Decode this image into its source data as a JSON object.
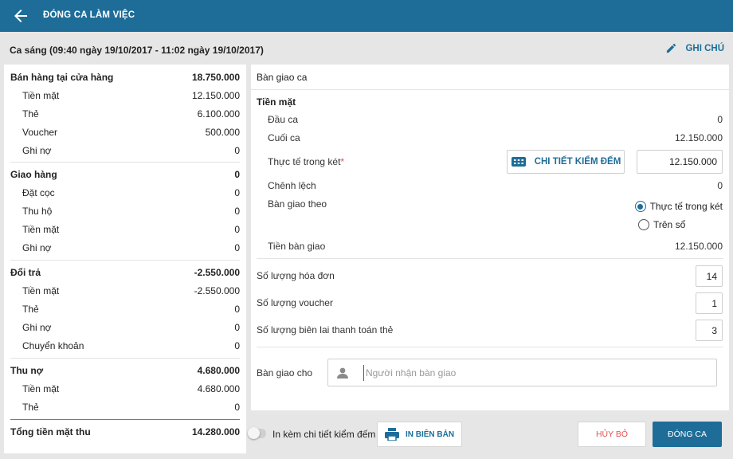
{
  "header": {
    "title": "ĐÓNG CA LÀM VIỆC"
  },
  "subheader": {
    "shift": "Ca sáng (09:40 ngày 19/10/2017 - 11:02 ngày 19/10/2017)",
    "note_label": "GHI CHÚ"
  },
  "summary": {
    "store_sales": {
      "label": "Bán hàng tại cửa hàng",
      "value": "18.750.000",
      "items": [
        {
          "label": "Tiền mặt",
          "value": "12.150.000"
        },
        {
          "label": "Thẻ",
          "value": "6.100.000"
        },
        {
          "label": "Voucher",
          "value": "500.000"
        },
        {
          "label": "Ghi nợ",
          "value": "0"
        }
      ]
    },
    "delivery": {
      "label": "Giao hàng",
      "value": "0",
      "items": [
        {
          "label": "Đặt cọc",
          "value": "0"
        },
        {
          "label": "Thu hộ",
          "value": "0"
        },
        {
          "label": "Tiền mặt",
          "value": "0"
        },
        {
          "label": "Ghi nợ",
          "value": "0"
        }
      ]
    },
    "returns": {
      "label": "Đổi trả",
      "value": "-2.550.000",
      "items": [
        {
          "label": "Tiền mặt",
          "value": "-2.550.000"
        },
        {
          "label": "Thẻ",
          "value": "0"
        },
        {
          "label": "Ghi nợ",
          "value": "0"
        },
        {
          "label": "Chuyển khoản",
          "value": "0"
        }
      ]
    },
    "debt_collection": {
      "label": "Thu nợ",
      "value": "4.680.000",
      "items": [
        {
          "label": "Tiền mặt",
          "value": "4.680.000"
        },
        {
          "label": "Thẻ",
          "value": "0"
        }
      ]
    },
    "total": {
      "label": "Tổng tiền mặt thu",
      "value": "14.280.000"
    }
  },
  "handover": {
    "title": "Bàn giao ca",
    "cash_section": "Tiền mặt",
    "opening": {
      "label": "Đầu ca",
      "value": "0"
    },
    "closing": {
      "label": "Cuối ca",
      "value": "12.150.000"
    },
    "actual": {
      "label": "Thực tế trong két",
      "required": "*",
      "value": "12.150.000"
    },
    "count_detail_button": "CHI TIẾT KIỂM ĐẾM",
    "difference": {
      "label": "Chênh lệch",
      "value": "0"
    },
    "handover_by": {
      "label": "Bàn giao theo",
      "options": [
        "Thực tế trong két",
        "Trên sổ"
      ],
      "selected": "Thực tế trong két"
    },
    "handover_amount": {
      "label": "Tiền bàn giao",
      "value": "12.150.000"
    },
    "invoice_count": {
      "label": "Số lượng hóa đơn",
      "value": "14"
    },
    "voucher_count": {
      "label": "Số lượng voucher",
      "value": "1"
    },
    "card_receipt_count": {
      "label": "Số lượng biên lai thanh toán thẻ",
      "value": "3"
    },
    "receiver": {
      "label": "Bàn giao cho",
      "placeholder": "Người nhận bàn giao",
      "value": ""
    }
  },
  "footer": {
    "include_count_detail": {
      "label": "In kèm chi tiết kiểm đếm",
      "on": false
    },
    "print_button": "IN BIÊN BẢN",
    "cancel_button": "HỦY BỎ",
    "close_shift_button": "ĐÓNG CA"
  },
  "colors": {
    "primary": "#1e6d99",
    "danger": "#e05252",
    "background": "#e6e6e6"
  }
}
